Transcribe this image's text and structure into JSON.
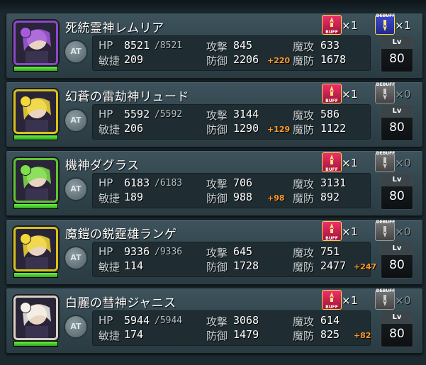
{
  "units": [
    {
      "name": "死統霊神レムリア",
      "mode": "AT",
      "hp_current": "8521",
      "hp_max": "/8521",
      "hp_fill": 1.0,
      "atk": "845",
      "matk": "633",
      "agi": "209",
      "def": "2206",
      "def_bonus": "+220",
      "mdef": "1678",
      "mdef_bonus": "",
      "lv": "80",
      "buff_count": "1",
      "debuff_count": "1",
      "frame_color": "#8a49c9",
      "element_color": "#a45be0"
    },
    {
      "name": "幻蒼の雷劫神リュード",
      "mode": "AT",
      "hp_current": "5592",
      "hp_max": "/5592",
      "hp_fill": 1.0,
      "atk": "3144",
      "matk": "586",
      "agi": "206",
      "def": "1290",
      "def_bonus": "+129",
      "mdef": "1122",
      "mdef_bonus": "",
      "lv": "80",
      "buff_count": "1",
      "debuff_count": "0",
      "frame_color": "#d6c21e",
      "element_color": "#f2d83a"
    },
    {
      "name": "機神ダグラス",
      "mode": "AT",
      "hp_current": "6183",
      "hp_max": "/6183",
      "hp_fill": 1.0,
      "atk": "706",
      "matk": "3131",
      "agi": "189",
      "def": "988",
      "def_bonus": "+98",
      "mdef": "892",
      "mdef_bonus": "",
      "lv": "80",
      "buff_count": "1",
      "debuff_count": "0",
      "frame_color": "#5fc436",
      "element_color": "#7ee04b"
    },
    {
      "name": "魔鎧の鋭霆雄ランゲ",
      "mode": "AT",
      "hp_current": "9336",
      "hp_max": "/9336",
      "hp_fill": 1.0,
      "atk": "645",
      "matk": "751",
      "agi": "114",
      "def": "1728",
      "def_bonus": "",
      "mdef": "2477",
      "mdef_bonus": "+247",
      "lv": "80",
      "buff_count": "1",
      "debuff_count": "0",
      "frame_color": "#d6c21e",
      "element_color": "#f2d83a"
    },
    {
      "name": "白麗の彗神ジャニス",
      "mode": "AT",
      "hp_current": "5944",
      "hp_max": "/5944",
      "hp_fill": 1.0,
      "atk": "3068",
      "matk": "614",
      "agi": "174",
      "def": "1479",
      "def_bonus": "",
      "mdef": "825",
      "mdef_bonus": "+82",
      "lv": "80",
      "buff_count": "1",
      "debuff_count": "0",
      "frame_color": "#d6d0c8",
      "element_color": "#f4f1ea"
    }
  ],
  "labels": {
    "hp": "HP",
    "atk": "攻撃",
    "matk": "魔攻",
    "agi": "敏捷",
    "def": "防御",
    "mdef": "魔防",
    "lv": "Lv",
    "buff": "BUFF",
    "debuff": "DEBUFF",
    "times": "×"
  },
  "colors": {
    "bonus": "#ff9a2a",
    "count_active": "#ffffff",
    "count_zero": "#8a969a"
  }
}
